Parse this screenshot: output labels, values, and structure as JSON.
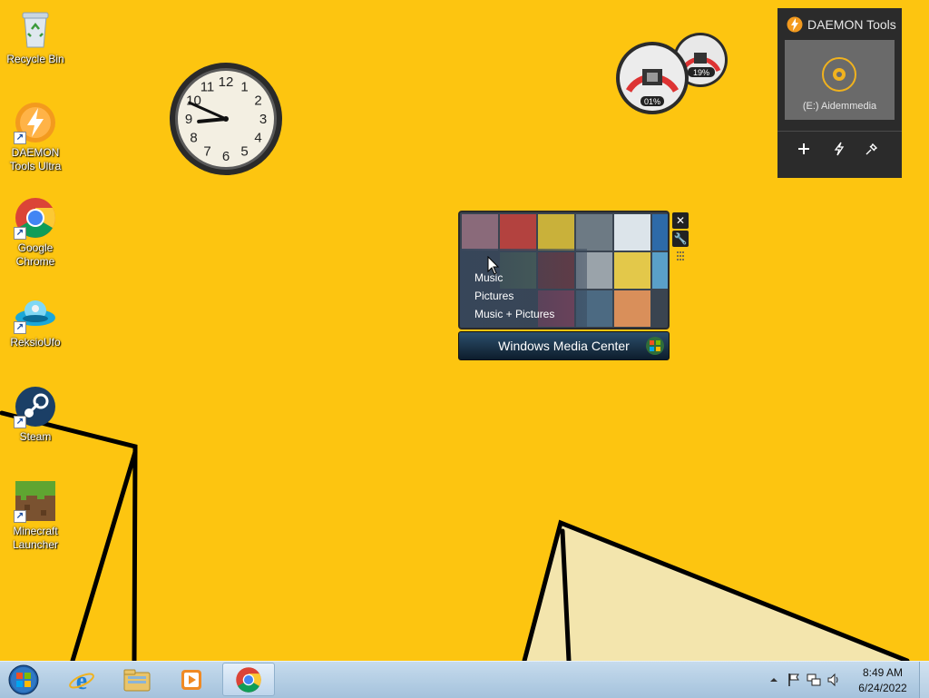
{
  "desktop": {
    "icons": [
      {
        "label": "Recycle Bin",
        "icon": "recycle-bin-icon"
      },
      {
        "label": "DAEMON Tools Ultra",
        "icon": "daemon-tools-icon"
      },
      {
        "label": "Google Chrome",
        "icon": "chrome-icon"
      },
      {
        "label": "ReksioUfo",
        "icon": "ufo-icon"
      },
      {
        "label": "Steam",
        "icon": "steam-icon"
      },
      {
        "label": "Minecraft Launcher",
        "icon": "minecraft-icon"
      }
    ]
  },
  "clock_gadget": {
    "time": "8:49",
    "numerals": [
      "12",
      "1",
      "2",
      "3",
      "4",
      "5",
      "6",
      "7",
      "8",
      "9",
      "10",
      "11"
    ]
  },
  "cpu_meter": {
    "cpu_label": "01%",
    "memory_label": "19%",
    "cpu_value": 1,
    "memory_value": 19
  },
  "daemon_gadget": {
    "title": "DAEMON Tools",
    "drive_label": "(E:) Aidemmedia",
    "buttons": [
      "add-icon",
      "flash-icon",
      "mount-icon"
    ]
  },
  "media_center_gadget": {
    "menu": [
      "Music",
      "Pictures",
      "Music + Pictures"
    ],
    "bar_label": "Windows Media Center",
    "side_buttons": {
      "close": "✕",
      "settings": "🔧"
    }
  },
  "taskbar": {
    "apps": [
      "internet-explorer-icon",
      "file-explorer-icon",
      "media-player-icon",
      "chrome-icon"
    ],
    "active_app": "chrome-icon",
    "time": "8:49 AM",
    "date": "6/24/2022",
    "tray_icons": [
      "chevron-up-icon",
      "flag-icon",
      "network-icon",
      "speaker-icon"
    ]
  },
  "colors": {
    "desktop_bg": "#fdc510",
    "taskbar": "#b8d2e8",
    "daemon_bg": "#2b2b2b"
  }
}
